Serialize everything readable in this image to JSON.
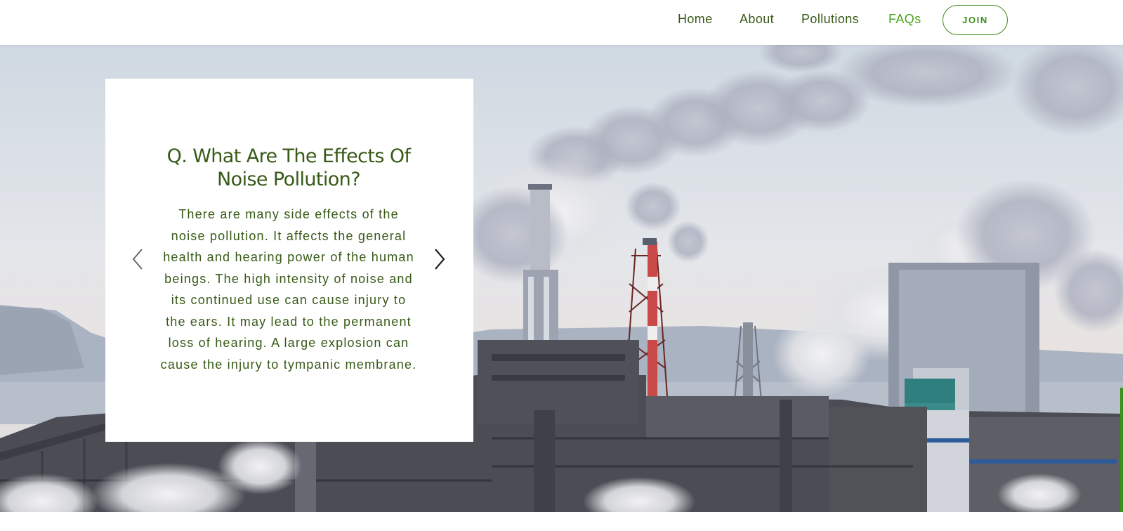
{
  "nav": {
    "items": [
      {
        "label": "Home",
        "active": false
      },
      {
        "label": "About",
        "active": false
      },
      {
        "label": "Pollutions",
        "active": false
      },
      {
        "label": "FAQs",
        "active": true
      }
    ],
    "join_label": "JOIN"
  },
  "faq": {
    "question": "Q. What Are The Effects Of Noise Pollution?",
    "answer": "There are many side effects of the noise pollution. It affects the general health and hearing power of the human beings. The high intensity of noise and its continued use can cause injury to the ears. It may lead to the permanent loss of hearing. A large explosion can cause the injury to tympanic membrane."
  },
  "icons": {
    "prev": "chevron-left-icon",
    "next": "chevron-right-icon"
  },
  "colors": {
    "text_green": "#375a17",
    "accent_green": "#4aa51c",
    "button_green": "#3d8c1b"
  },
  "hero": {
    "background": "industrial factory smokestacks photo"
  }
}
